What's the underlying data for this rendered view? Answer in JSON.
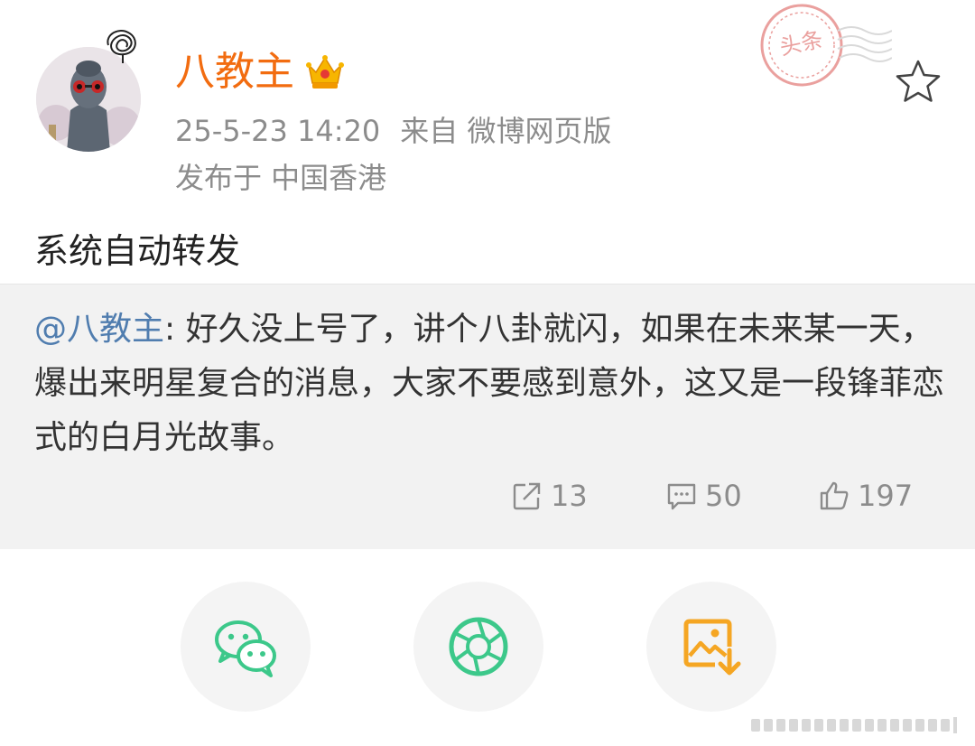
{
  "user": {
    "name": "八教主",
    "avatar_icon": "buddha-statue-avatar-icon",
    "badge_icon": "crown-badge-icon"
  },
  "meta": {
    "time": "25-5-23 14:20",
    "source": "来自 微博网页版",
    "location": "发布于 中国香港"
  },
  "stamp": {
    "text": "头条",
    "color": "#d9534f"
  },
  "post": {
    "text": "系统自动转发"
  },
  "quote": {
    "mention": "@八教主",
    "text": ": 好久没上号了，讲个八卦就闪，如果在未来某一天，爆出来明星复合的消息，大家不要感到意外，这又是一段锋菲恋式的白月光故事。"
  },
  "stats": {
    "reposts": "13",
    "comments": "50",
    "likes": "197"
  },
  "share": [
    {
      "name": "wechat",
      "icon": "wechat-icon",
      "color": "#3cc88a"
    },
    {
      "name": "moments",
      "icon": "moments-icon",
      "color": "#3cc88a"
    },
    {
      "name": "save-image",
      "icon": "save-image-icon",
      "color": "#f5a623"
    }
  ],
  "colors": {
    "username": "#f26c10",
    "mention": "#507daf",
    "meta": "#8c8c8c",
    "quote_bg": "#f2f2f2"
  }
}
